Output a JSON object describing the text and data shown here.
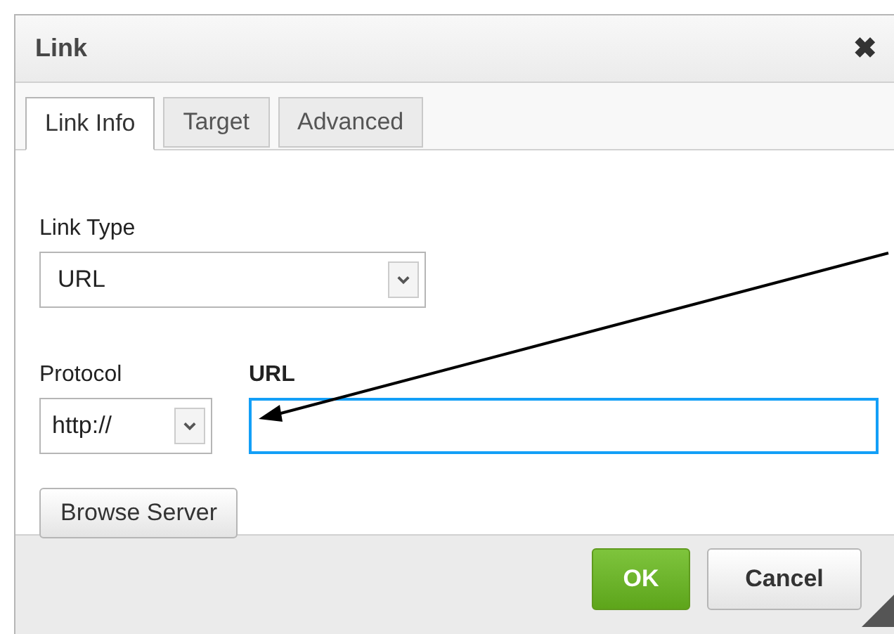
{
  "window": {
    "title": "Link",
    "close": "✖"
  },
  "tabs": [
    {
      "label": "Link Info",
      "selected": true
    },
    {
      "label": "Target",
      "selected": false
    },
    {
      "label": "Advanced",
      "selected": false
    }
  ],
  "link_type": {
    "label": "Link Type",
    "value": "URL"
  },
  "protocol": {
    "label": "Protocol",
    "value": "http://"
  },
  "url": {
    "label": "URL",
    "focused": true
  },
  "browse_button": "Browse Server",
  "buttons": [
    {
      "label": "OK",
      "kind": "primary"
    },
    {
      "label": "Cancel",
      "kind": "secondary"
    }
  ]
}
